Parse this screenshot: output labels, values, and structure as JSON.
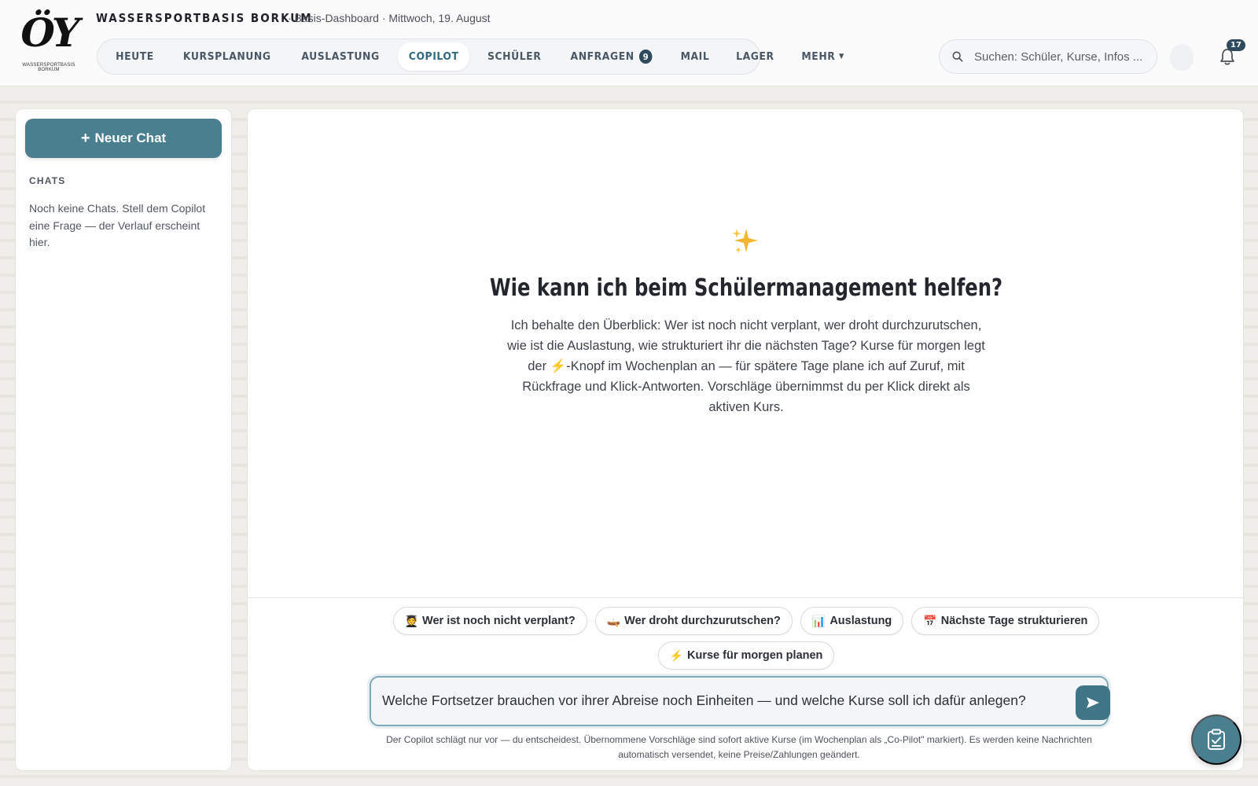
{
  "brand": {
    "logo_text": "ÖY",
    "logo_sub": "WASSERSPORTBASIS BORKUM",
    "name": "WASSERSPORTBASIS BORKUM",
    "breadcrumb": "· Basis-Dashboard · Mittwoch, 19. August"
  },
  "nav": {
    "items": [
      {
        "label": "HEUTE"
      },
      {
        "label": "KURSPLANUNG"
      },
      {
        "label": "AUSLASTUNG"
      },
      {
        "label": "COPILOT",
        "active": true
      },
      {
        "label": "SCHÜLER"
      },
      {
        "label": "ANFRAGEN",
        "badge": "9"
      },
      {
        "label": "MAIL"
      },
      {
        "label": "LAGER"
      },
      {
        "label": "MEHR"
      }
    ]
  },
  "search": {
    "placeholder": "Suchen: Schüler, Kurse, Infos ..."
  },
  "notifications": {
    "count": "17"
  },
  "sidebar": {
    "new_chat_label": "Neuer Chat",
    "chats_heading": "CHATS",
    "empty_text": "Noch keine Chats. Stell dem Copilot eine Frage — der Verlauf erscheint hier."
  },
  "main": {
    "title": "Wie kann ich beim Schülermanagement helfen?",
    "intro": "Ich behalte den Überblick: Wer ist noch nicht verplant, wer droht durchzurutschen, wie ist die Auslastung, wie strukturiert ihr die nächsten Tage? Kurse für morgen legt der ⚡-Knopf im Wochenplan an — für spätere Tage plane ich auf Zuruf, mit Rückfrage und Klick-Antworten. Vorschläge übernimmst du per Klick direkt als aktiven Kurs.",
    "chips_row1": [
      {
        "icon": "🧑‍🎓",
        "label": "Wer ist noch nicht verplant?"
      },
      {
        "icon": "🛶",
        "label": "Wer droht durchzurutschen?"
      },
      {
        "icon": "📊",
        "label": "Auslastung"
      },
      {
        "icon": "📅",
        "label": "Nächste Tage strukturieren"
      }
    ],
    "chips_row2": [
      {
        "icon": "⚡",
        "label": "Kurse für morgen planen"
      }
    ],
    "composer_value": "Welche Fortsetzer brauchen vor ihrer Abreise noch Einheiten — und welche Kurse soll ich dafür anlegen?",
    "disclaimer": "Der Copilot schlägt nur vor — du entscheidest. Übernommene Vorschläge sind sofort aktive Kurse (im Wochenplan als „Co-Pilot\" markiert). Es werden keine Nachrichten automatisch versendet, keine Preise/Zahlungen geändert."
  },
  "colors": {
    "accent": "#4a7f90",
    "accent_dark": "#3f7587",
    "badge": "#2f4a5c"
  }
}
